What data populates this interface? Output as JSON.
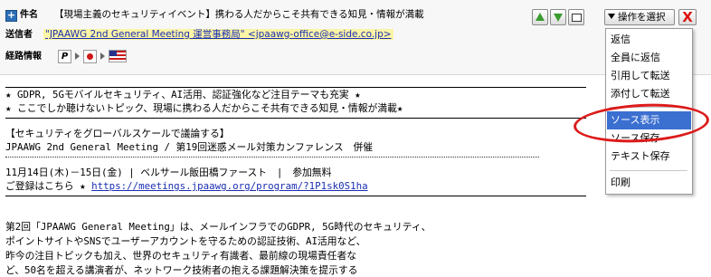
{
  "header": {
    "subject_label": "件名",
    "subject": "【現場主義のセキュリティイベント】携わる人だからこそ共有できる知見・情報が満載",
    "sender_label": "送信者",
    "sender": "\"JPAAWG 2nd General Meeting 運営事務局\" <jpaawg-office@e-side.co.jp>",
    "route_label": "経路情報",
    "route_box": "P",
    "action_label": "操作を選択",
    "close_label": "X"
  },
  "body": {
    "line1": "★ GDPR, 5Gモバイルセキュリティ、AI活用、認証強化など注目テーマも充実 ★",
    "line2": "★ ここでしか聴けないトピック、現場に携わる人だからこそ共有できる知見・情報が満載★",
    "line3": "【セキュリティをグローバルスケールで議論する】",
    "line4": "JPAAWG 2nd General Meeting / 第19回迷惑メール対策カンファレンス　併催",
    "line5": "11月14日(木)－15日(金) | ベルサール飯田橋ファースト　|　参加無料",
    "line6_prefix": "ご登録はこちら ★ ",
    "line6_link": "https://meetings.jpaawg.org/program/?1P1sk0S1ha",
    "line7": "第2回「JPAAWG General Meeting」は、メールインフラでのGDPR, 5G時代のセキュリティ、",
    "line8": "ポイントサイトやSNSでユーザーアカウントを守るための認証技術、AI活用など、",
    "line9": "昨今の注目トピックも加え、世界のセキュリティ有識者、最前線の現場責任者な",
    "line10": "ど、50名を超える講演者が、ネットワーク技術者の抱える課題解決策を提示する"
  },
  "menu": {
    "items": [
      "返信",
      "全員に返信",
      "引用して転送",
      "添付して転送",
      "ソース表示",
      "ソース保存",
      "テキスト保存",
      "印刷"
    ],
    "selected": "ソース表示"
  },
  "colors": {
    "menu_selected": "#3b6fd0",
    "highlight_ellipse": "#dd1a1a",
    "link": "#1a2fb3",
    "sender_bg": "#fbf3a6"
  }
}
